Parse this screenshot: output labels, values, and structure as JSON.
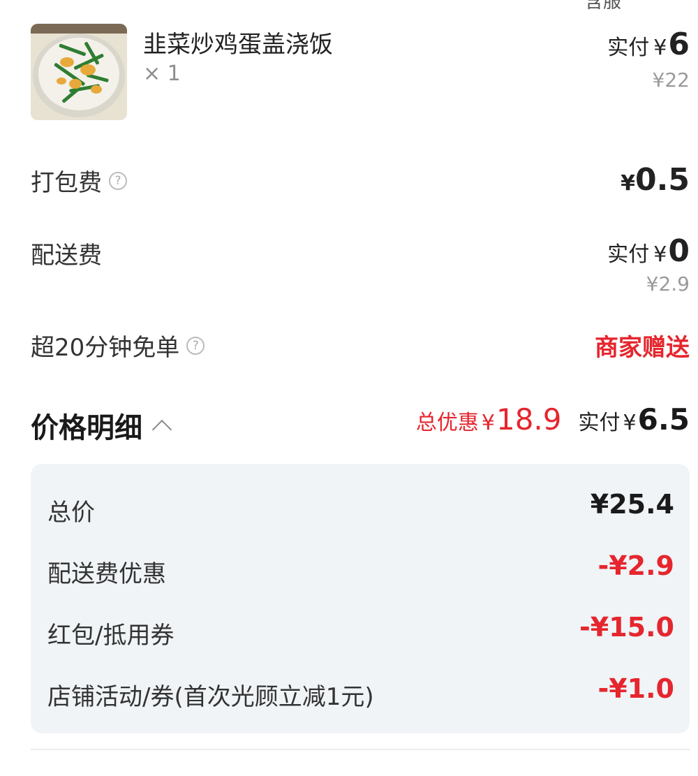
{
  "top_cut_text": "含服",
  "item": {
    "name": "韭菜炒鸡蛋盖浇饭",
    "qty": "× 1",
    "pay_label": "实付",
    "currency": "¥",
    "pay_value": "6",
    "original_price": "¥22",
    "image_icon": "rice-bowl-photo"
  },
  "packing": {
    "label": "打包费",
    "help": "?",
    "currency": "¥",
    "value": "0.5"
  },
  "delivery": {
    "label": "配送费",
    "pay_label": "实付",
    "currency": "¥",
    "value": "0",
    "original_price": "¥2.9"
  },
  "overtime": {
    "label": "超20分钟免单",
    "help": "?",
    "value": "商家赠送"
  },
  "price_detail": {
    "title": "价格明细",
    "total_discount_label": "总优惠",
    "currency": "¥",
    "total_discount": "18.9",
    "pay_label": "实付",
    "pay_value": "6.5",
    "rows": [
      {
        "label": "总价",
        "value": "¥25.4"
      },
      {
        "label": "配送费优惠",
        "value": "-¥2.9"
      },
      {
        "label": "红包/抵用券",
        "value": "-¥15.0"
      },
      {
        "label": "店铺活动/券(首次光顾立减1元)",
        "value": "-¥1.0"
      }
    ]
  },
  "colors": {
    "accent_red": "#e5262e",
    "panel_bg": "#f0f4f7"
  }
}
